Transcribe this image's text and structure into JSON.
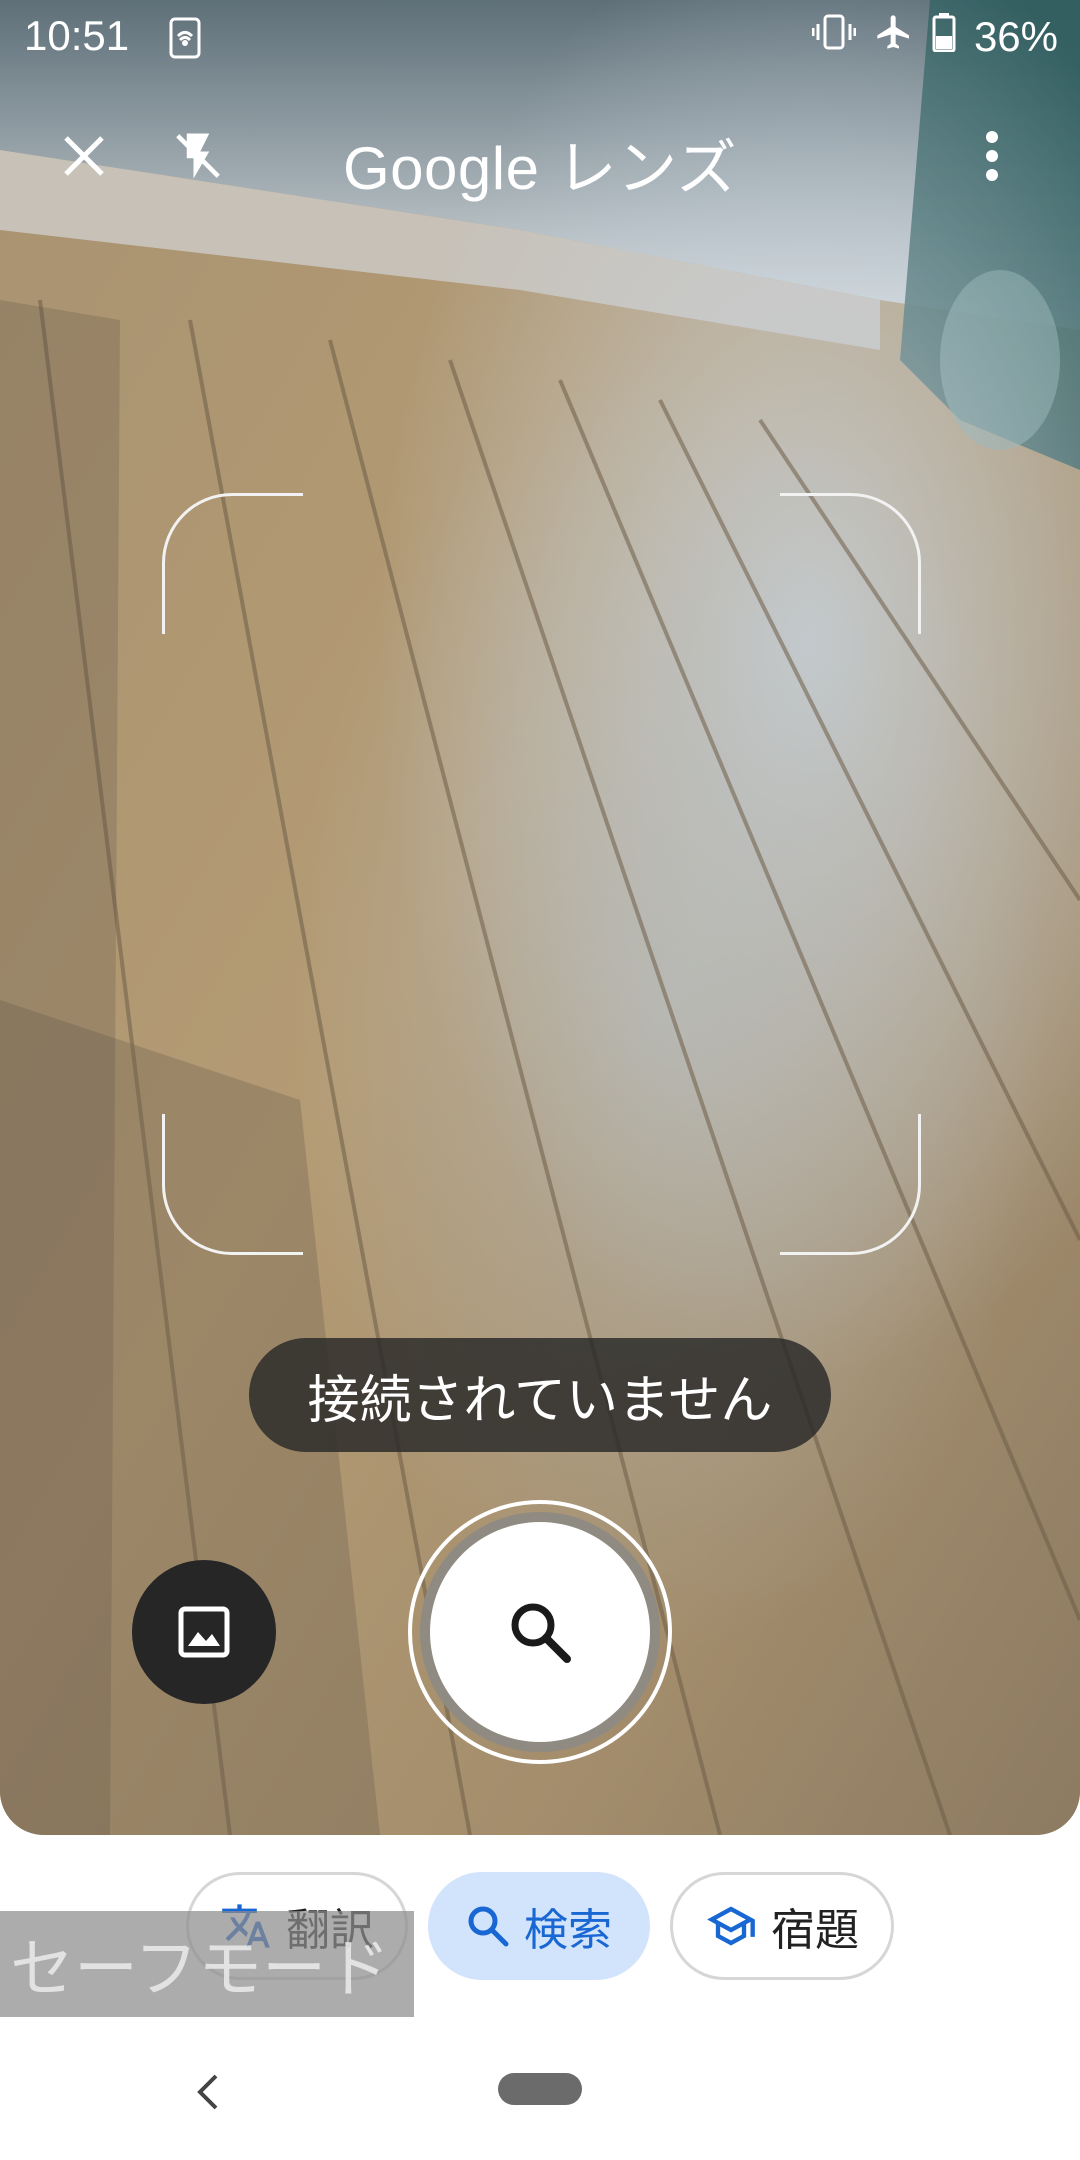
{
  "status_bar": {
    "time": "10:51",
    "battery_percent": "36%",
    "icons": [
      "nfc-icon",
      "vibrate-icon",
      "airplane-icon",
      "battery-icon"
    ]
  },
  "toolbar": {
    "title": "Google レンズ",
    "close_icon": "close-icon",
    "flash_icon": "flash-off-icon",
    "menu_icon": "more-vert-icon"
  },
  "toast": {
    "message": "接続されていません"
  },
  "controls": {
    "gallery_icon": "image-icon",
    "shutter_icon": "search-icon"
  },
  "modes": [
    {
      "label": "翻訳",
      "icon": "translate-icon",
      "selected": false
    },
    {
      "label": "検索",
      "icon": "search-icon",
      "selected": true
    },
    {
      "label": "宿題",
      "icon": "school-icon",
      "selected": false
    }
  ],
  "safe_mode": {
    "label": "セーフモード"
  },
  "nav": {
    "back_icon": "back-chevron-icon",
    "home_icon": "home-pill-icon"
  },
  "colors": {
    "selected_chip_bg": "#d2e3fc",
    "selected_chip_text": "#1967d2",
    "toast_bg": "#282828"
  }
}
